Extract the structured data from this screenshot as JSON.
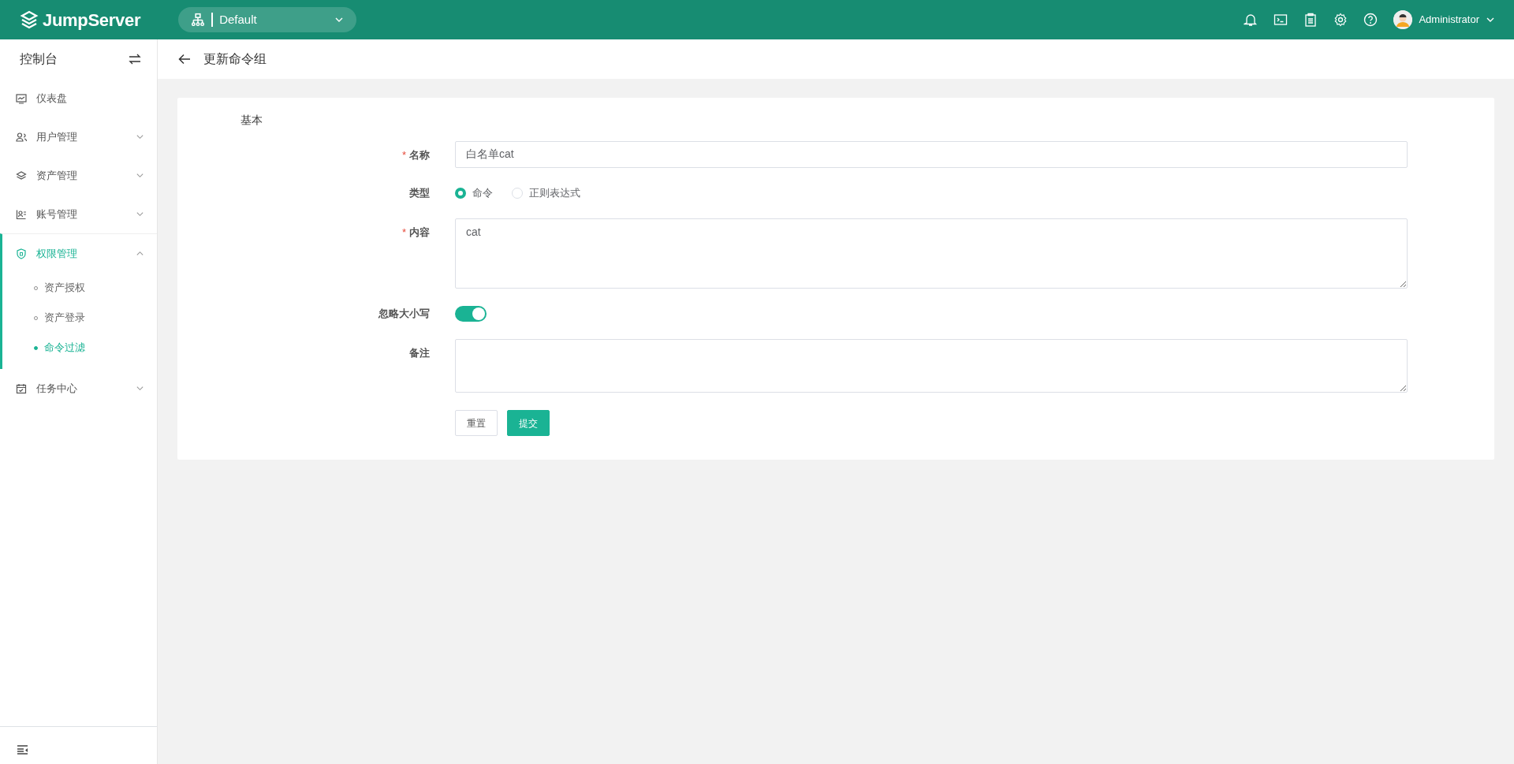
{
  "topbar": {
    "logo_text": "JumpServer",
    "org_selector": {
      "value": "Default"
    },
    "user": {
      "name": "Administrator"
    }
  },
  "sidebar": {
    "title": "控制台",
    "items": [
      {
        "label": "仪表盘",
        "kind": "link",
        "selected": false
      },
      {
        "label": "用户管理",
        "kind": "group",
        "selected": false,
        "expanded": false
      },
      {
        "label": "资产管理",
        "kind": "group",
        "selected": false,
        "expanded": false
      },
      {
        "label": "账号管理",
        "kind": "group",
        "selected": false,
        "expanded": false
      },
      {
        "label": "权限管理",
        "kind": "group",
        "selected": true,
        "expanded": true,
        "children": [
          {
            "label": "资产授权",
            "selected": false
          },
          {
            "label": "资产登录",
            "selected": false
          },
          {
            "label": "命令过滤",
            "selected": true
          }
        ]
      },
      {
        "label": "任务中心",
        "kind": "group",
        "selected": false,
        "expanded": false
      }
    ]
  },
  "page": {
    "title": "更新命令组"
  },
  "form": {
    "section_title": "基本",
    "fields": [
      {
        "kind": "text",
        "label": "名称",
        "required_mark": "*",
        "value": "白名单cat"
      },
      {
        "kind": "radio",
        "label": "类型",
        "options": [
          {
            "label": "命令",
            "selected": true
          },
          {
            "label": "正则表达式",
            "selected": false
          }
        ]
      },
      {
        "kind": "textarea",
        "label": "内容",
        "required_mark": "*",
        "value": "cat"
      },
      {
        "kind": "switch",
        "label": "忽略大小写",
        "on": true
      },
      {
        "kind": "textarea",
        "label": "备注"
      }
    ],
    "buttons": [
      {
        "label": "重置",
        "kind": "default"
      },
      {
        "label": "提交",
        "kind": "primary"
      }
    ]
  }
}
